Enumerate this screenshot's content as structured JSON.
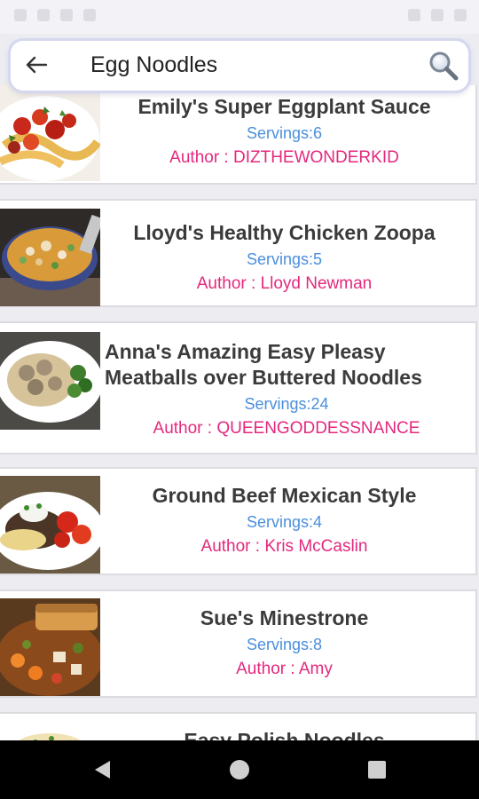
{
  "search": {
    "query": "Egg Noodles"
  },
  "recipes": [
    {
      "title": "Emily's Super Eggplant Sauce",
      "servings": "Servings:6",
      "author": "Author : DIZTHEWONDERKID"
    },
    {
      "title": "Lloyd's Healthy Chicken Zoopa",
      "servings": "Servings:5",
      "author": "Author : Lloyd Newman"
    },
    {
      "title_line1": "Anna's Amazing Easy Pleasy",
      "title_line2": "Meatballs over Buttered Noodles",
      "servings": "Servings:24",
      "author": "Author : QUEENGODDESSNANCE"
    },
    {
      "title": "Ground Beef Mexican Style",
      "servings": "Servings:4",
      "author": "Author : Kris McCaslin"
    },
    {
      "title": "Sue's Minestrone",
      "servings": "Servings:8",
      "author": "Author : Amy"
    },
    {
      "title": "Easy Polish Noodles"
    }
  ],
  "colors": {
    "servings": "#4a8fdc",
    "author": "#e4287d",
    "title": "#3b3b3b",
    "background": "#ececf1"
  },
  "icons": {
    "back": "arrow-left-icon",
    "search": "magnifier-icon",
    "nav": [
      "back-triangle-icon",
      "home-circle-icon",
      "recents-square-icon"
    ]
  }
}
